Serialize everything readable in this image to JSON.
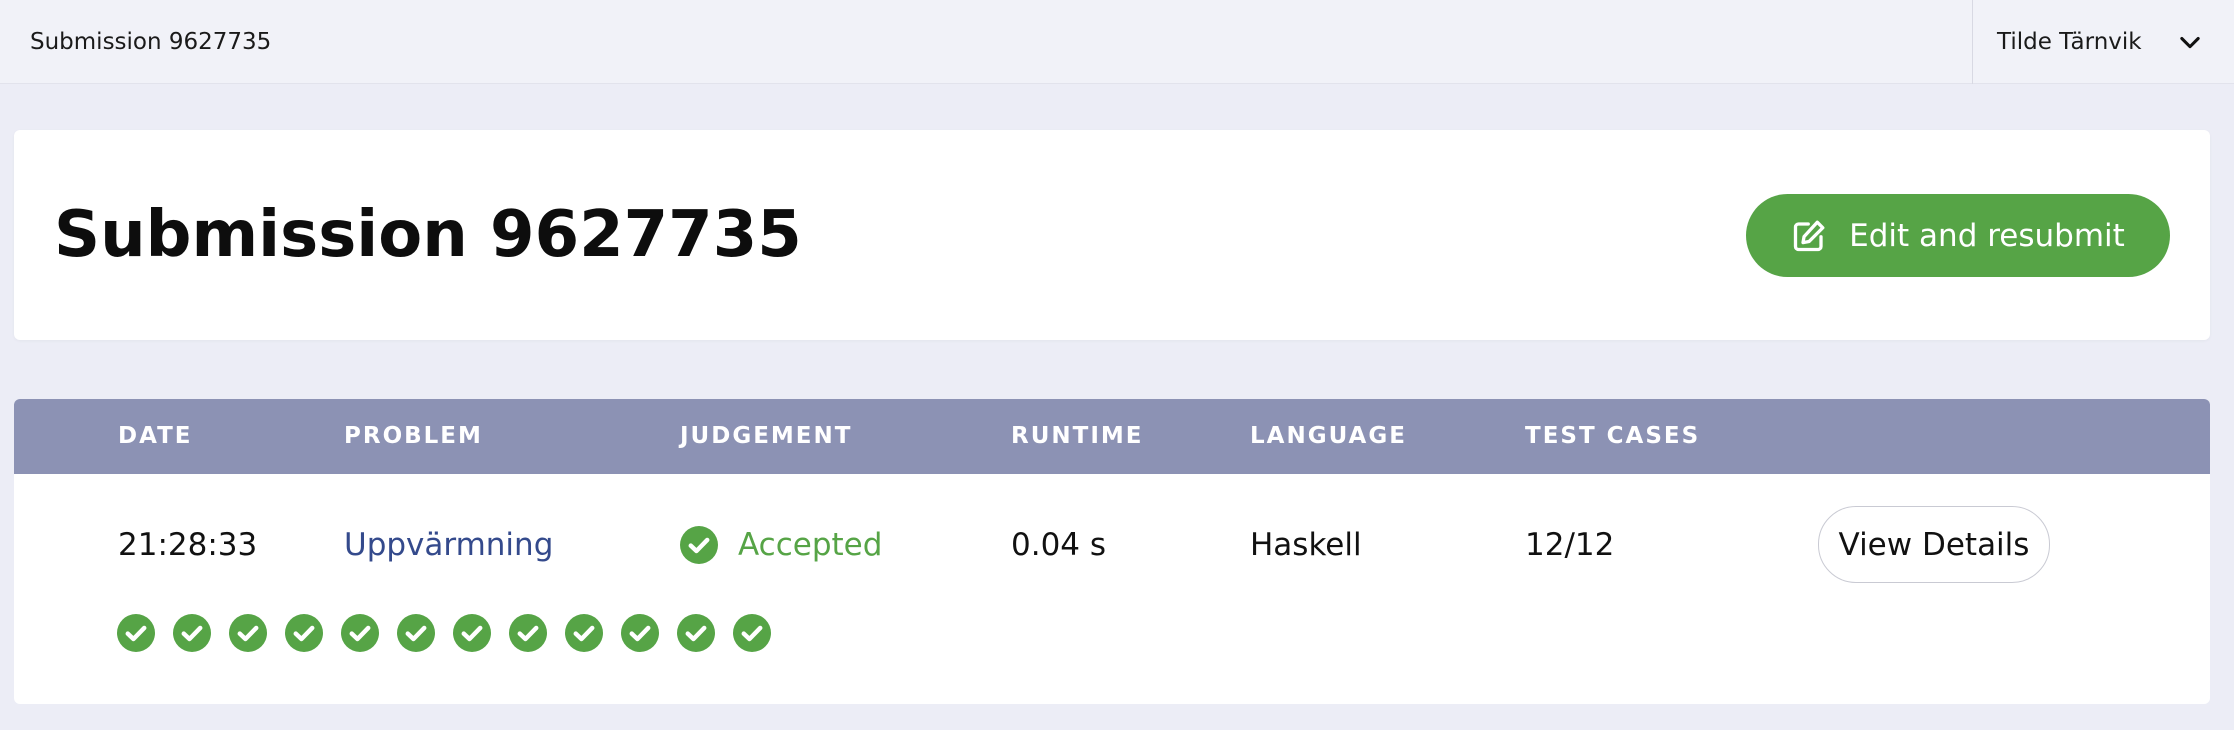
{
  "topbar": {
    "title": "Submission 9627735",
    "user_name": "Tilde Tärnvik",
    "user_menu_icon": "chevron-down-icon"
  },
  "header": {
    "title": "Submission 9627735",
    "resubmit_label": "Edit and resubmit",
    "resubmit_icon": "edit-icon"
  },
  "table": {
    "columns": [
      "DATE",
      "PROBLEM",
      "JUDGEMENT",
      "RUNTIME",
      "LANGUAGE",
      "TEST CASES"
    ],
    "row": {
      "date": "21:28:33",
      "problem": "Uppvärmning",
      "judgement": "Accepted",
      "runtime": "0.04 s",
      "language": "Haskell",
      "test_cases": "12/12",
      "view_label": "View Details"
    },
    "test_case_results": [
      "accepted",
      "accepted",
      "accepted",
      "accepted",
      "accepted",
      "accepted",
      "accepted",
      "accepted",
      "accepted",
      "accepted",
      "accepted",
      "accepted"
    ]
  },
  "colors": {
    "accent_green": "#56a446",
    "table_header": "#8c92b4",
    "link_blue": "#344a8c",
    "background": "#ecedf6"
  }
}
